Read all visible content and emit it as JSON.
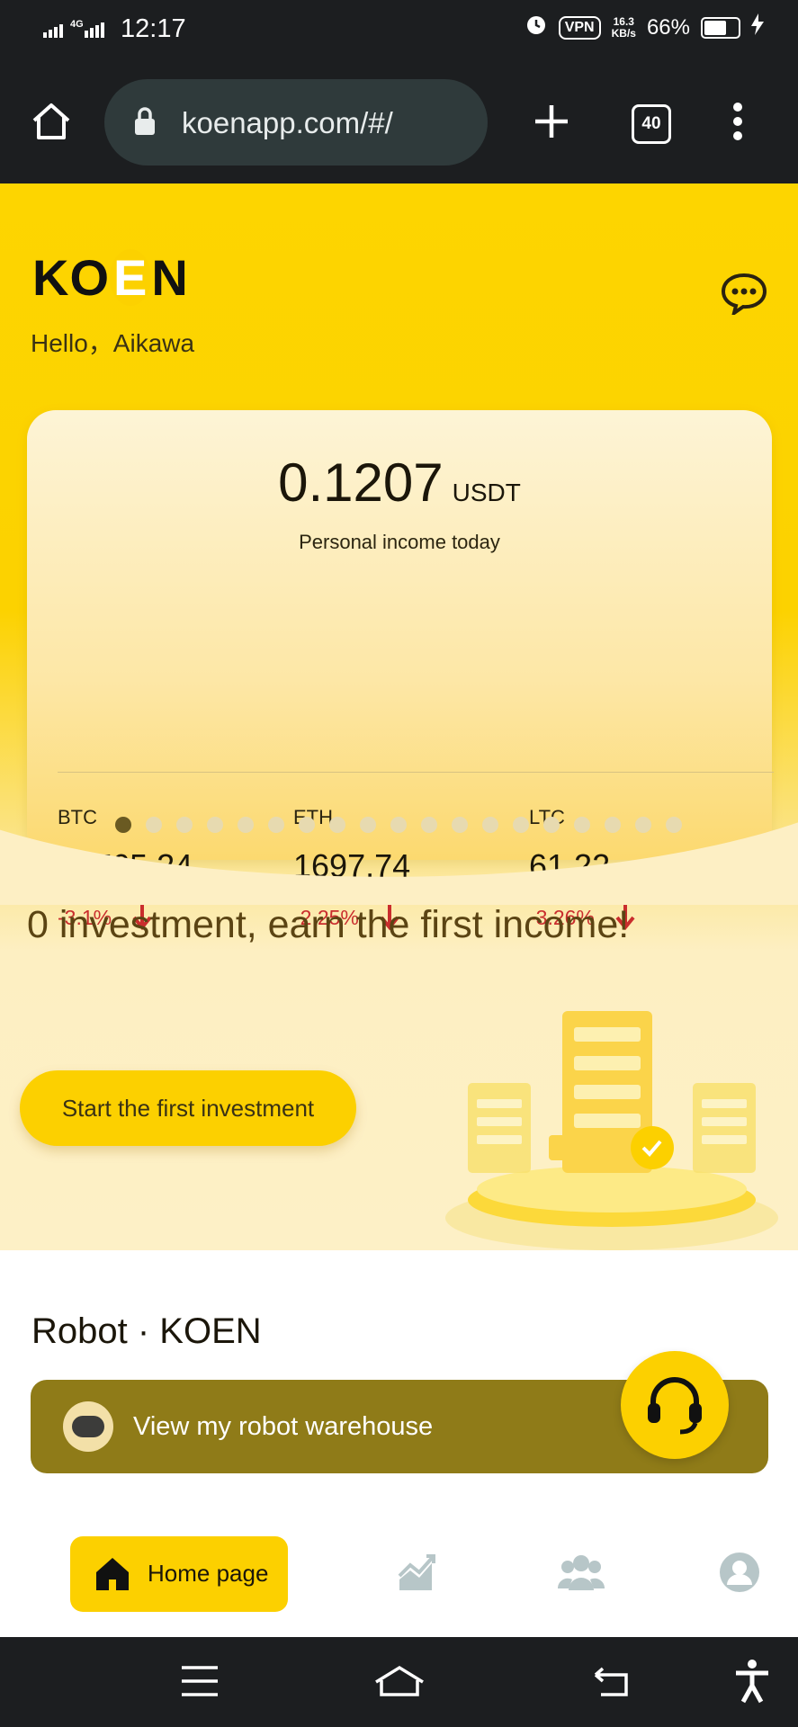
{
  "status_bar": {
    "time": "12:17",
    "network": "4G",
    "vpn": "VPN",
    "speed_value": "16.3",
    "speed_unit": "KB/s",
    "battery": "66%"
  },
  "browser": {
    "url": "koenapp.com/#/",
    "tab_count": "40"
  },
  "header": {
    "logo_prefix": "KO",
    "logo_e": "E",
    "logo_suffix": "N",
    "greeting": "Hello，Aikawa"
  },
  "income_card": {
    "amount": "0.1207",
    "unit": "USDT",
    "caption": "Personal income today",
    "coins": [
      {
        "name": "BTC",
        "price": "23765.24",
        "change": "-3.1%"
      },
      {
        "name": "ETH",
        "price": "1697.74",
        "change": "-2.25%"
      },
      {
        "name": "LTC",
        "price": "61.22",
        "change": "-3.26%"
      }
    ],
    "carousel": {
      "total": 19,
      "active": 0
    }
  },
  "promo": {
    "headline": "0 investment, earn the first income!",
    "button": "Start the first investment"
  },
  "robot": {
    "title": "Robot · KOEN",
    "bar_label": "View my robot warehouse"
  },
  "bottom_nav": {
    "home_label": "Home page"
  },
  "colors": {
    "brand_yellow": "#fcd000",
    "down_red": "#c92d2d",
    "robot_bar": "#8f7b18"
  }
}
